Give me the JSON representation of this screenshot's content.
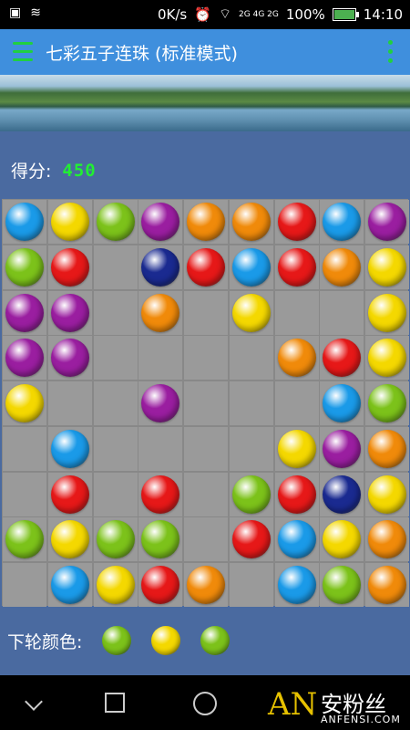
{
  "status_bar": {
    "speed": "0K/s",
    "network": "2G 4G 2G",
    "battery": "100%",
    "time": "14:10"
  },
  "app_bar": {
    "title": "七彩五子连珠 (标准模式)"
  },
  "score": {
    "label": "得分:",
    "value": "450"
  },
  "board": {
    "rows": [
      [
        "blue",
        "yellow",
        "green",
        "purple",
        "orange",
        "orange",
        "red",
        "blue",
        "purple"
      ],
      [
        "green",
        "red",
        "",
        "navy",
        "red",
        "blue",
        "red",
        "orange",
        "yellow"
      ],
      [
        "purple",
        "purple",
        "",
        "orange",
        "",
        "yellow",
        "",
        "",
        "yellow"
      ],
      [
        "purple",
        "purple",
        "",
        "",
        "",
        "",
        "orange",
        "red",
        "yellow"
      ],
      [
        "yellow",
        "",
        "",
        "purple",
        "",
        "",
        "",
        "blue",
        "green"
      ],
      [
        "",
        "blue",
        "",
        "",
        "",
        "",
        "yellow",
        "purple",
        "orange"
      ],
      [
        "",
        "red",
        "",
        "red",
        "",
        "green",
        "red",
        "navy",
        "yellow"
      ],
      [
        "green",
        "yellow",
        "green",
        "green",
        "",
        "red",
        "blue",
        "yellow",
        "orange"
      ],
      [
        "",
        "blue",
        "yellow",
        "red",
        "orange",
        "",
        "blue",
        "green",
        "orange"
      ]
    ]
  },
  "next_colors": {
    "label": "下轮颜色:",
    "balls": [
      "green",
      "yellow",
      "green"
    ]
  },
  "colors": {
    "blue": "#1a9ae8",
    "yellow": "#f4d800",
    "green": "#7cc21a",
    "purple": "#9a1ea0",
    "orange": "#f08a0a",
    "red": "#e61818",
    "navy": "#1a2a90",
    "appbar": "#3f8fdd",
    "background": "#4a6aa0",
    "score_digits": "#22ee33"
  },
  "watermark": {
    "cn": "安粉丝",
    "en": "ANFENSI.COM"
  }
}
